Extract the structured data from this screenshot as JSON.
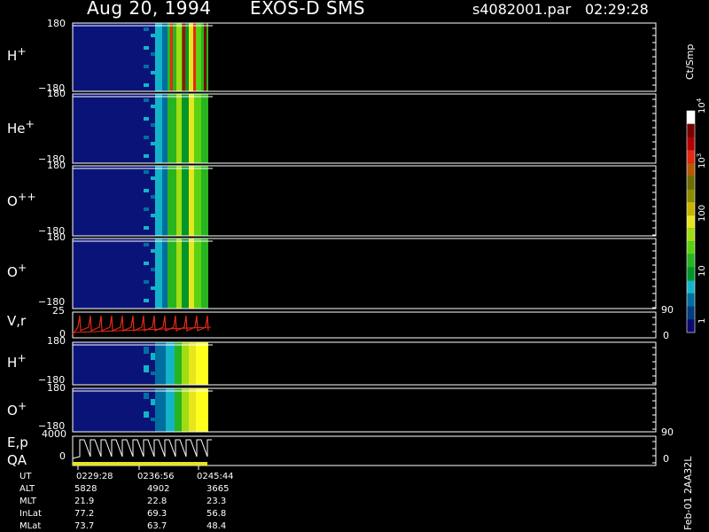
{
  "header": {
    "date": "Aug 20, 1994",
    "mission": "EXOS-D SMS",
    "file": "s4082001.par",
    "time": "02:29:28"
  },
  "colorbar": {
    "unit": "Ct/Smp",
    "ticks": [
      "1",
      "10",
      "100",
      "10",
      "10"
    ],
    "tick_exponents": [
      "",
      "",
      "",
      "3",
      "4"
    ],
    "colors": [
      "#0a0a6e",
      "#003c82",
      "#006ea0",
      "#14b4c8",
      "#009628",
      "#28b41e",
      "#5ad214",
      "#a0dc14",
      "#e6e61e",
      "#c8b400",
      "#8c8c00",
      "#6e6e00",
      "#b45a00",
      "#e62814",
      "#b40000",
      "#780000",
      "#ffffff"
    ]
  },
  "footer": {
    "credit": "Feb-01 2AA32L"
  },
  "ephemeris": {
    "labels": [
      "UT",
      "ALT",
      "MLT",
      "InLat",
      "MLat"
    ],
    "rows": [
      [
        "0229:28",
        "0236:56",
        "0245:44"
      ],
      [
        "5828",
        "4902",
        "3665"
      ],
      [
        "21.9",
        "22.8",
        "23.3"
      ],
      [
        "77.2",
        "69.3",
        "56.8"
      ],
      [
        "73.7",
        "63.7",
        "48.4"
      ]
    ]
  },
  "chart_data": {
    "type": "heatmap",
    "x_ticks": [
      "0229:28",
      "0236:56",
      "0245:44"
    ],
    "panels": [
      {
        "label": "H",
        "sup": "+",
        "ytop": "180",
        "ybottom": "−180",
        "kind": "pitch"
      },
      {
        "label": "He",
        "sup": "+",
        "ytop": "180",
        "ybottom": "−180",
        "kind": "pitch"
      },
      {
        "label": "O",
        "sup": "++",
        "ytop": "180",
        "ybottom": "−180",
        "kind": "pitch"
      },
      {
        "label": "O",
        "sup": "+",
        "ytop": "180",
        "ybottom": "−180",
        "kind": "pitch"
      },
      {
        "label": "V,r",
        "sup": "",
        "ytop": "25",
        "ybottom": "0",
        "right_top": "90",
        "right_bottom": "0",
        "kind": "line"
      },
      {
        "label": "H",
        "sup": "+",
        "ytop": "180",
        "ybottom": "−180",
        "kind": "pitch"
      },
      {
        "label": "O",
        "sup": "+",
        "ytop": "180",
        "ybottom": "−180",
        "kind": "pitch"
      },
      {
        "label": "E,p",
        "label2": "QA",
        "sup": "",
        "ytop": "4000",
        "ybottom": "0",
        "right_top": "90",
        "right_bottom": "0",
        "kind": "line"
      }
    ]
  }
}
